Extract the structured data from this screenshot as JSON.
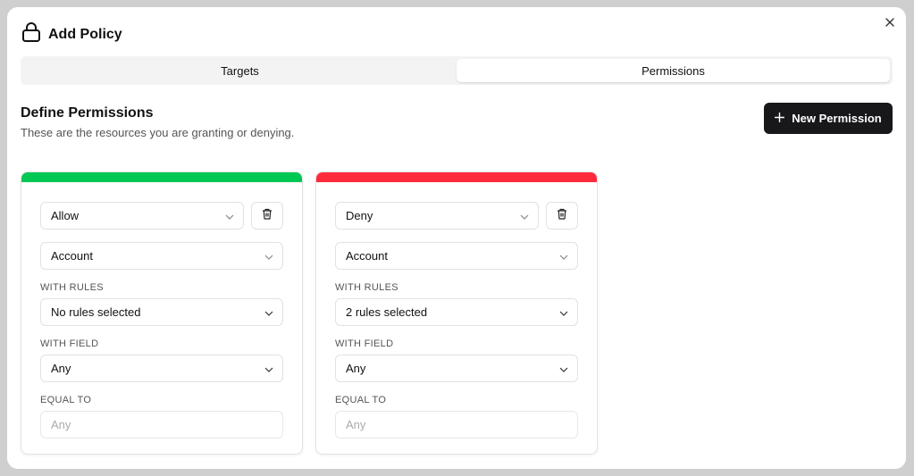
{
  "dialog": {
    "title": "Add Policy",
    "icon": "lock-icon"
  },
  "tabs": [
    {
      "label": "Targets",
      "active": false
    },
    {
      "label": "Permissions",
      "active": true
    }
  ],
  "section": {
    "title": "Define Permissions",
    "subtitle": "These are the resources you are granting or denying.",
    "new_button_label": "New Permission"
  },
  "colors": {
    "allow": "#00c853",
    "deny": "#ff2b3d",
    "primary_button": "#18181b"
  },
  "cards": [
    {
      "effect": "Allow",
      "resource": "Account",
      "rules_label": "WITH RULES",
      "rules_value": "No rules selected",
      "field_label": "WITH FIELD",
      "field_value": "Any",
      "equal_label": "EQUAL TO",
      "equal_placeholder": "Any"
    },
    {
      "effect": "Deny",
      "resource": "Account",
      "rules_label": "WITH RULES",
      "rules_value": "2 rules selected",
      "field_label": "WITH FIELD",
      "field_value": "Any",
      "equal_label": "EQUAL TO",
      "equal_placeholder": "Any"
    }
  ]
}
